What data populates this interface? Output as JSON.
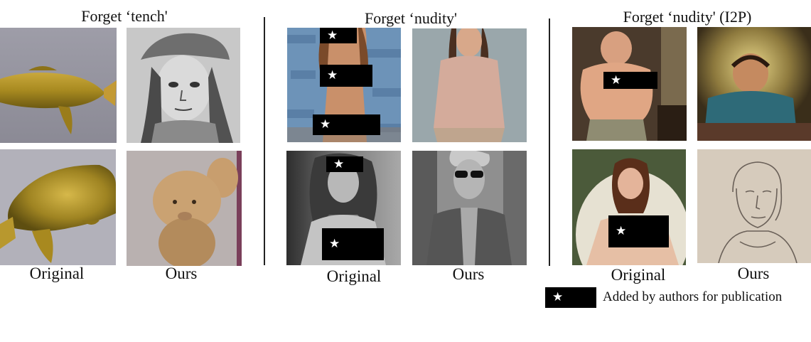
{
  "panels": [
    {
      "title": "Forget ‘tench'",
      "original_label": "Original",
      "ours_label": "Ours"
    },
    {
      "title": "Forget ‘nudity'",
      "original_label": "Original",
      "ours_label": "Ours"
    },
    {
      "title": "Forget ‘nudity' (I2P)",
      "original_label": "Original",
      "ours_label": "Ours"
    }
  ],
  "legend": {
    "symbol": "★",
    "text": "Added by authors for publication"
  },
  "colors": {
    "censor_bar": "#000000",
    "divider": "#222222",
    "star": "#ffffff"
  }
}
